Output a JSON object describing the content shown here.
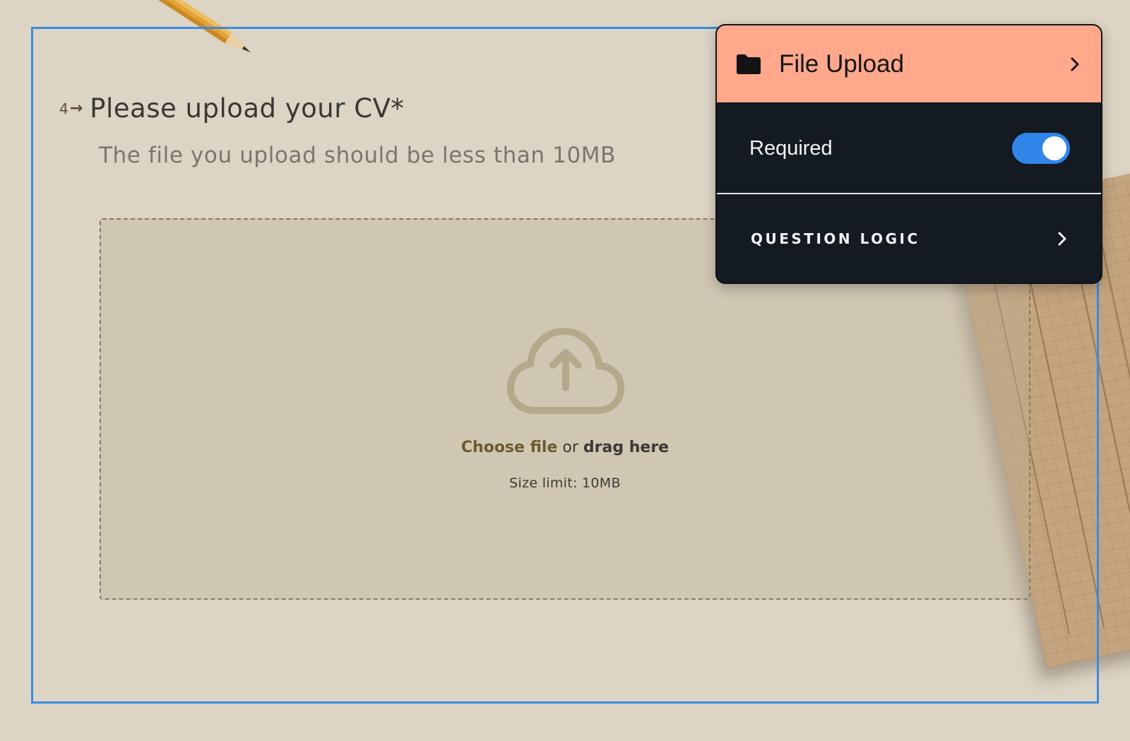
{
  "question": {
    "number": "4",
    "title": "Please upload your CV*",
    "description": "The file you upload should be less than 10MB"
  },
  "dropzone": {
    "choose_label": "Choose file",
    "or_label": "or",
    "drag_label": "drag here",
    "size_limit": "Size limit: 10MB"
  },
  "panel": {
    "title": "File Upload",
    "required_label": "Required",
    "required_on": true,
    "logic_label": "QUESTION LOGIC"
  },
  "colors": {
    "background": "#dcd4c4",
    "selection_frame": "#3b8be0",
    "panel_header": "#ffa88b",
    "panel_body": "#131a22",
    "toggle_on": "#2f86e8"
  },
  "icons": {
    "question_arrow": "arrow-right-icon",
    "upload": "cloud-upload-icon",
    "panel_type": "folder-icon",
    "chevron": "chevron-right-icon"
  }
}
